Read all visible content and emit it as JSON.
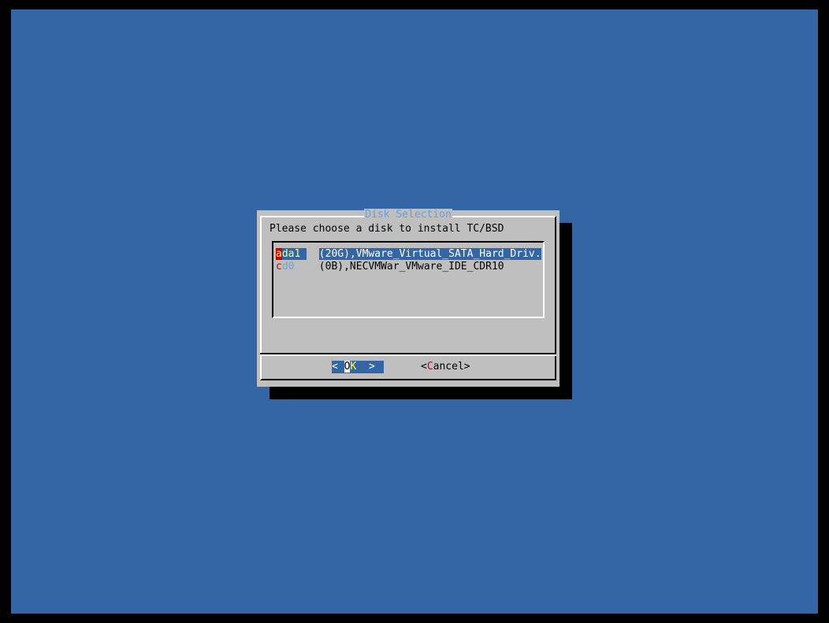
{
  "dialog": {
    "title": "Disk Selection",
    "prompt": "Please choose a disk to install TC/BSD"
  },
  "disks": [
    {
      "hotkey": "a",
      "tag_rest": "da1",
      "description": "(20G),VMware_Virtual_SATA_Hard_Driv.",
      "selected": true
    },
    {
      "hotkey": "c",
      "tag_rest": "d0",
      "description": "(0B),NECVMWar_VMware_IDE_CDR10",
      "selected": false
    }
  ],
  "buttons": {
    "ok": {
      "left_bracket": "< ",
      "hotkey": "O",
      "rest": "K",
      "right_bracket": "  >"
    },
    "cancel": {
      "left_bracket": "<",
      "hotkey": "C",
      "rest": "ancel",
      "right_bracket": ">"
    }
  },
  "colors": {
    "background": "#3465a4",
    "dialog": "#bfbfbf",
    "highlight": "#3465a4",
    "hotkey": "#cc0000",
    "title": "#6f9fd4"
  }
}
